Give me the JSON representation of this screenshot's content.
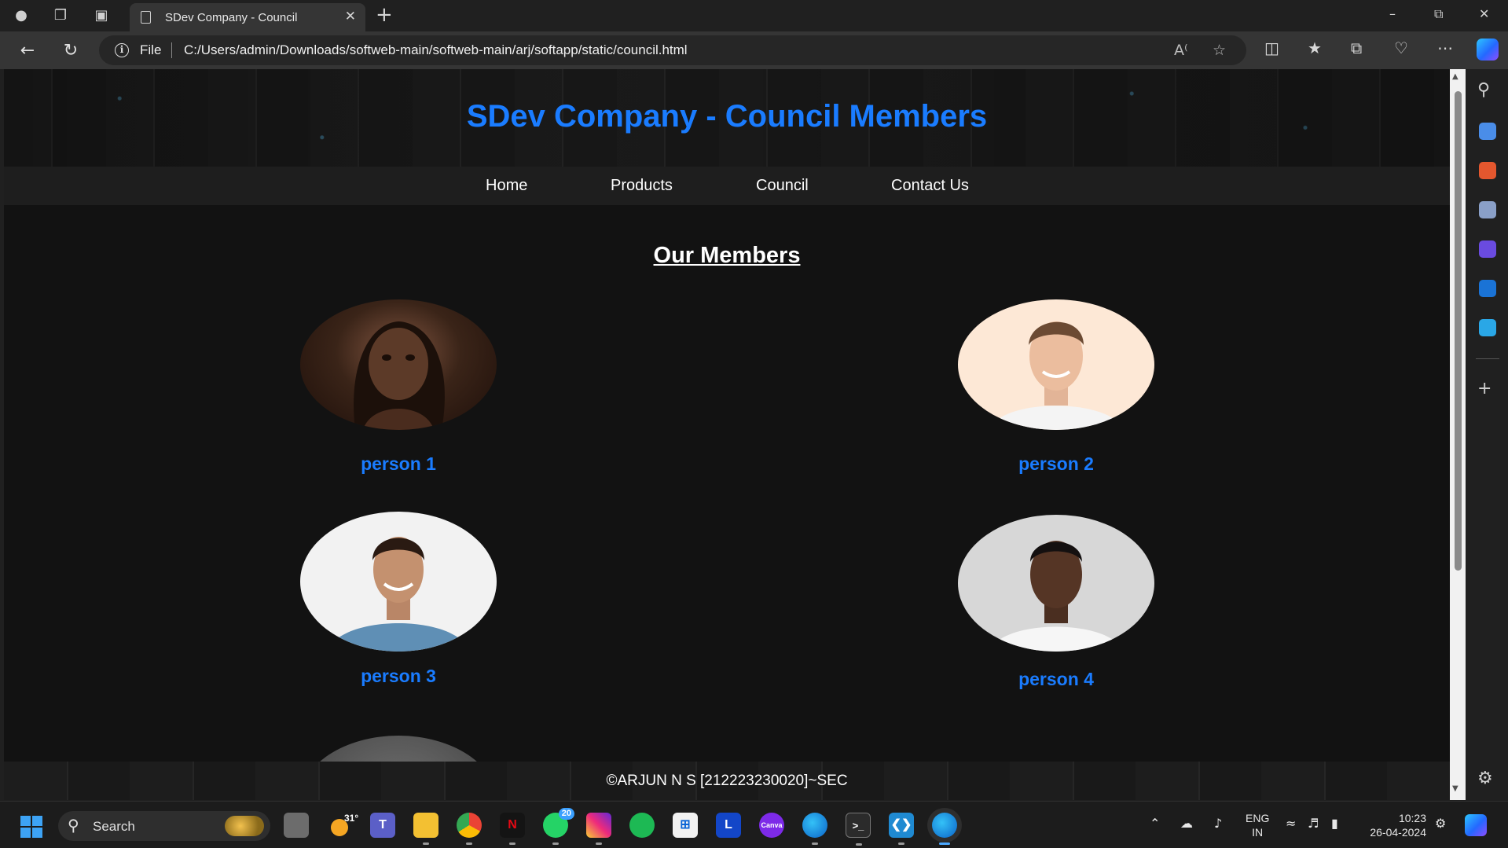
{
  "browser": {
    "tab_title": "SDev Company - Council",
    "address_scheme": "File",
    "url": "C:/Users/admin/Downloads/softweb-main/softweb-main/arj/softapp/static/council.html"
  },
  "page": {
    "title": "SDev Company - Council Members",
    "nav": [
      "Home",
      "Products",
      "Council",
      "Contact Us"
    ],
    "section_title": "Our Members",
    "members": [
      "person 1",
      "person 2",
      "person 3",
      "person 4"
    ],
    "footer": "©ARJUN N S [212223230020]~SEC"
  },
  "taskbar": {
    "search_label": "Search",
    "weather": "31°",
    "whatsapp_badge": "20",
    "lang_line1": "ENG",
    "lang_line2": "IN",
    "time": "10:23",
    "date": "26-04-2024"
  },
  "colors": {
    "accent_blue": "#1a7cff",
    "page_bg": "#121212",
    "nav_bg": "#1e1e1e"
  }
}
